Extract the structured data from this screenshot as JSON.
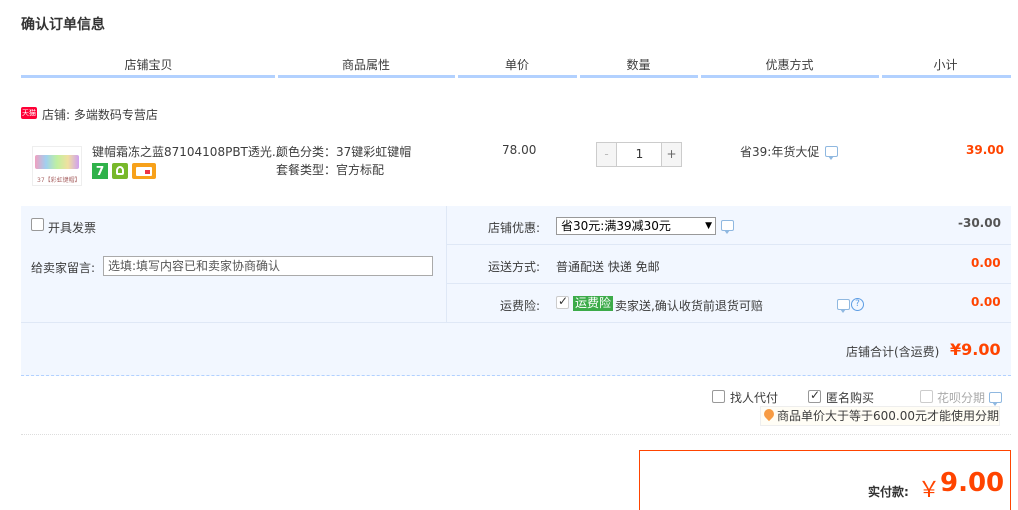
{
  "page": {
    "title": "确认订单信息"
  },
  "columns": [
    "店铺宝贝",
    "商品属性",
    "单价",
    "数量",
    "优惠方式",
    "小计"
  ],
  "shop": {
    "badge": "天猫",
    "label": "店铺: 多端数码专营店"
  },
  "item": {
    "thumb_caption": "37【彩虹键帽】",
    "title": "键帽霜冻之蓝87104108PBT透光...",
    "attrs": [
      "颜色分类：37键彩虹键帽",
      "套餐类型：官方标配"
    ],
    "price": "78.00",
    "qty_minus": "-",
    "qty": "1",
    "qty_plus": "+",
    "promo": "省39:年货大促",
    "subtotal": "39.00",
    "service_icons": [
      "seven-day-return-icon",
      "quality-badge-icon",
      "card-payment-icon"
    ]
  },
  "options": {
    "invoice_label": "开具发票",
    "message_label": "给卖家留言:",
    "message_placeholder": "选填:填写内容已和卖家协商确认",
    "coupon_label": "店铺优惠:",
    "coupon_selected": "省30元:满39减30元",
    "coupon_amount": "-30.00",
    "shipping_label": "运送方式:",
    "shipping_value": "普通配送 快递 免邮",
    "shipping_amount": "0.00",
    "insurance_label": "运费险:",
    "insurance_tag": "运费险",
    "insurance_desc": "卖家送,确认收货前退货可赔",
    "insurance_amount": "0.00",
    "shop_total_label": "店铺合计(含运费)",
    "shop_total": "¥9.00"
  },
  "checkout": {
    "proxy_pay": "找人代付",
    "anonymous": "匿名购买",
    "installment": "花呗分期",
    "installment_tip": "商品单价大于等于600.00元才能使用分期",
    "actual_label": "实付款:",
    "currency": "￥",
    "actual_amount": "9.00"
  },
  "colors": {
    "accent_red": "#ff4400",
    "header_line": "#b2d1ff",
    "panel_bg": "#f2f7ff"
  }
}
